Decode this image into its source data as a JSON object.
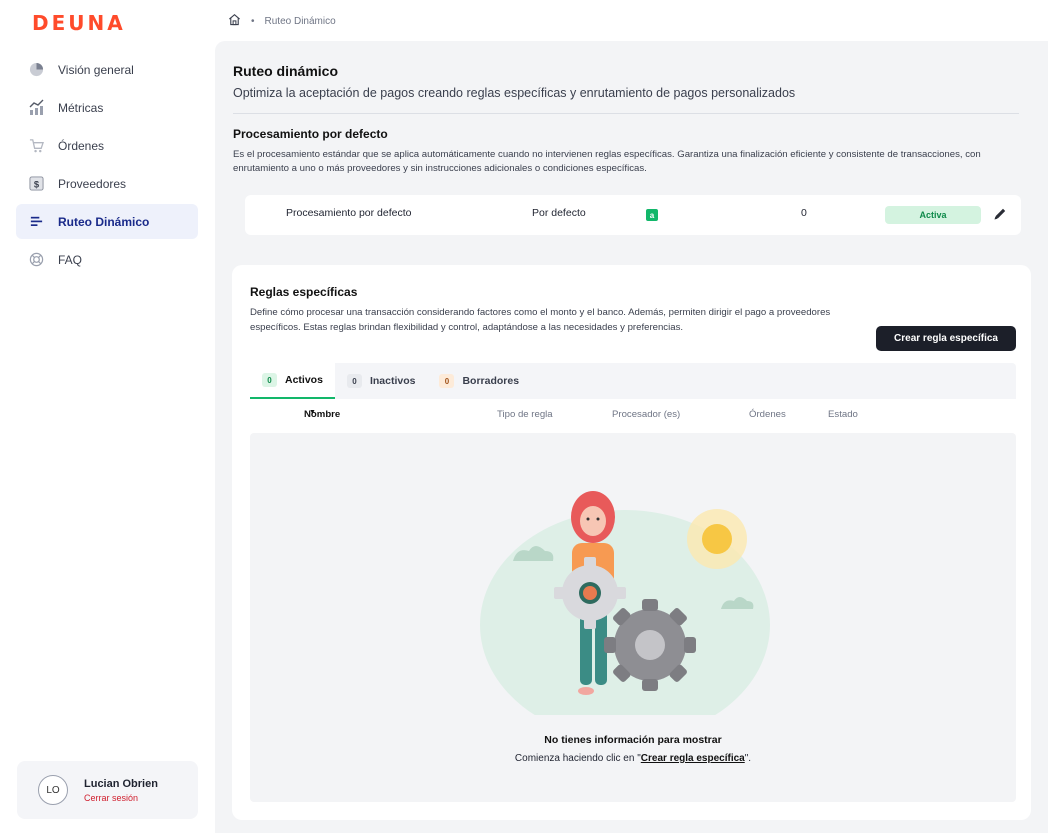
{
  "brand": {
    "logo_text": "DEUNA",
    "accent": "#ff4b2b"
  },
  "sidebar": {
    "items": [
      {
        "label": "Visión general",
        "icon": "pie-chart-icon",
        "active": false
      },
      {
        "label": "Métricas",
        "icon": "bar-chart-icon",
        "active": false
      },
      {
        "label": "Órdenes",
        "icon": "cart-icon",
        "active": false
      },
      {
        "label": "Proveedores",
        "icon": "dollar-icon",
        "active": false
      },
      {
        "label": "Ruteo Dinámico",
        "icon": "routing-icon",
        "active": true
      },
      {
        "label": "FAQ",
        "icon": "lifebuoy-icon",
        "active": false
      }
    ],
    "user": {
      "initials": "LO",
      "name": "Lucian Obrien",
      "logout": "Cerrar sesión"
    }
  },
  "breadcrumb": {
    "home_icon": "home-icon",
    "separator": "•",
    "current": "Ruteo Dinámico"
  },
  "header": {
    "title": "Ruteo dinámico",
    "subtitle": "Optimiza la aceptación de pagos creando reglas específicas y enrutamiento de pagos personalizados"
  },
  "default_processing": {
    "title": "Procesamiento por defecto",
    "description": "Es el procesamiento estándar que se aplica automáticamente cuando no intervienen reglas específicas. Garantiza una finalización eficiente y consistente de transacciones, con enrutamiento a uno o más proveedores y sin instrucciones adicionales o condiciones específicas.",
    "row": {
      "name": "Procesamiento por defecto",
      "type": "Por defecto",
      "processor_icon": "processor-logo-icon",
      "orders": "0",
      "status": "Activa"
    }
  },
  "rules": {
    "title": "Reglas específicas",
    "description": "Define cómo procesar una transacción considerando factores como el monto y el banco. Además, permiten dirigir el pago a proveedores específicos. Estas reglas brindan flexibilidad y control, adaptándose a las necesidades y preferencias.",
    "create_button": "Crear regla específica",
    "tabs": [
      {
        "count": "0",
        "label": "Activos",
        "active": true
      },
      {
        "count": "0",
        "label": "Inactivos",
        "active": false
      },
      {
        "count": "0",
        "label": "Borradores",
        "active": false
      }
    ],
    "columns": {
      "name": "Nombre",
      "rule_type": "Tipo de regla",
      "processors": "Procesador (es)",
      "orders": "Órdenes",
      "status": "Estado"
    },
    "empty": {
      "title": "No tienes información para mostrar",
      "prefix": "Comienza haciendo clic en ",
      "open_quote": "\"",
      "link": "Crear regla específica",
      "suffix": "\"."
    }
  },
  "colors": {
    "success": "#12b76a",
    "dark_button": "#1c1f29",
    "active_nav": "#eef1fb"
  }
}
